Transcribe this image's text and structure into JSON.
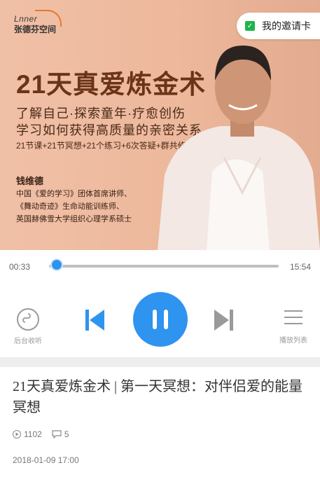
{
  "banner": {
    "logo_mark": "Lnner",
    "logo_name": "张德芬空间",
    "invite_label": "我的邀请卡",
    "title": "21天真爱炼金术",
    "subtitle_line1": "了解自己·探索童年·疗愈创伤",
    "subtitle_line2": "学习如何获得高质量的亲密关系",
    "course_meta": "21节课+21节冥想+21个练习+6次答疑+群共修",
    "speaker_name": "钱维德",
    "credentials": [
      "中国《爱的学习》团体首席讲师、",
      "《舞动奇迹》生命动能训练师、",
      "英国赫佛雪大学组织心理学系硕士"
    ]
  },
  "player": {
    "current_time": "00:33",
    "total_time": "15:54",
    "progress_fraction": 0.035,
    "accent_color": "#2f93f0",
    "background_label": "后台收听",
    "playlist_label": "播放列表"
  },
  "episode": {
    "title": "21天真爱炼金术 | 第一天冥想：对伴侣爱的能量冥想",
    "plays": "1102",
    "comments": "5",
    "date": "2018-01-09 17:00"
  }
}
